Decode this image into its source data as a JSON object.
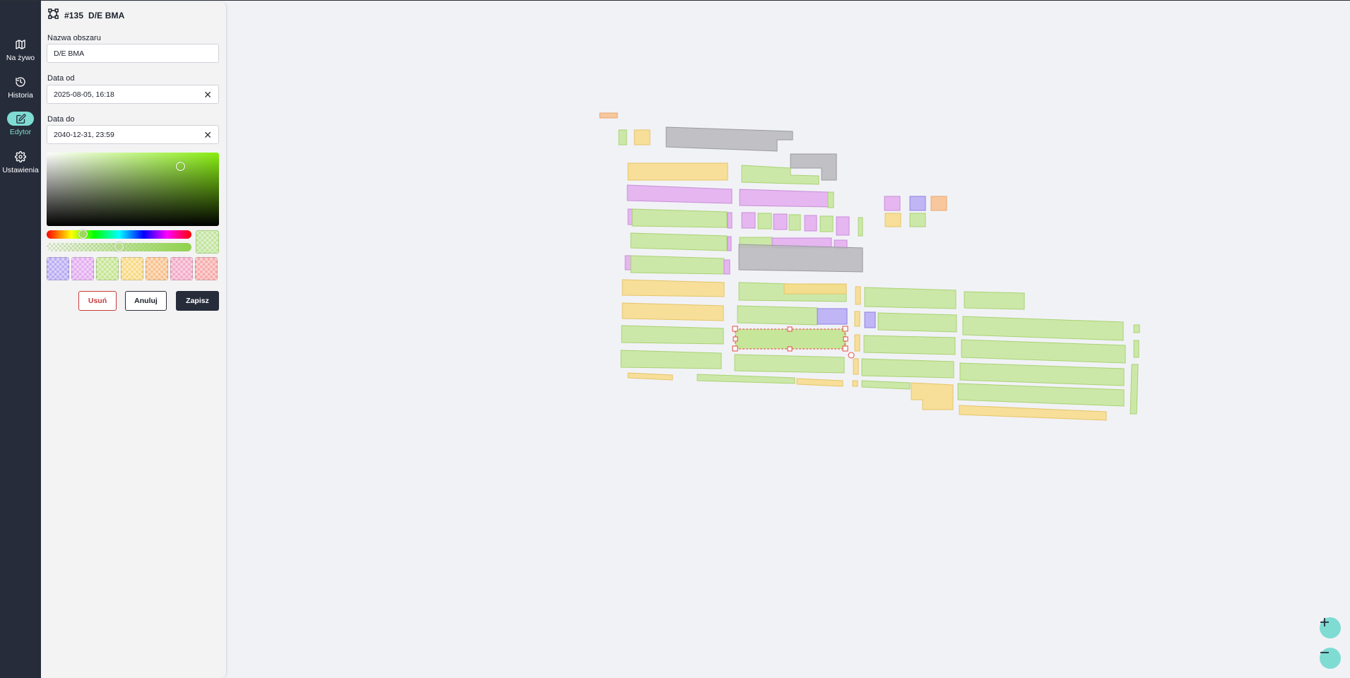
{
  "nav": {
    "items": [
      {
        "label": "Na żywo",
        "icon": "map-icon"
      },
      {
        "label": "Historia",
        "icon": "history-icon"
      },
      {
        "label": "Edytor",
        "icon": "edit-icon",
        "active": true
      },
      {
        "label": "Ustawienia",
        "icon": "gear-icon"
      }
    ]
  },
  "panel": {
    "title": "#135  D/E BMA",
    "name_label": "Nazwa obszaru",
    "name_value": "D/E BMA",
    "date_from_label": "Data od",
    "date_from_value": "2025-08-05, 16:18",
    "date_to_label": "Data do",
    "date_to_value": "2040-12-31, 23:59",
    "clear_glyph": "✕",
    "selected_color": "#bfe39a",
    "swatches": [
      "#b7a8f2",
      "#e2a9f0",
      "#c3e48e",
      "#f8d77e",
      "#f8be87",
      "#f2a8c4",
      "#f7a7a7"
    ],
    "buttons": {
      "delete": "Usuń",
      "cancel": "Anuluj",
      "save": "Zapisz"
    }
  },
  "colors": {
    "accent": "#7fdcd3",
    "nav_bg": "#262c3a",
    "green": "#c6e69a",
    "yellow": "#f8dc8a",
    "purple": "#e3acef",
    "violet": "#b7acf5",
    "orange": "#f9c08e",
    "gray": "#b8b9bc",
    "selection": "#e44a3c"
  },
  "zoom": {
    "in_icon": "plus-icon",
    "out_icon": "minus-icon"
  }
}
